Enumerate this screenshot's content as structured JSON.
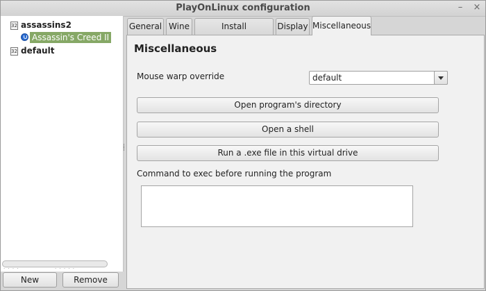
{
  "window": {
    "title": "PlayOnLinux configuration",
    "minimize_glyph": "–",
    "close_glyph": "×"
  },
  "tree": {
    "prefixes": [
      {
        "icon_text": "32",
        "label": "assassins2",
        "children": [
          {
            "label": "Assassin's Creed II",
            "selected": true
          }
        ]
      },
      {
        "icon_text": "32",
        "label": "default",
        "children": []
      }
    ]
  },
  "left_buttons": {
    "new_label": "New",
    "remove_label": "Remove"
  },
  "tabs": [
    {
      "label": "General",
      "active": false
    },
    {
      "label": "Wine",
      "active": false
    },
    {
      "label": "Install components",
      "active": false
    },
    {
      "label": "Display",
      "active": false
    },
    {
      "label": "Miscellaneous",
      "active": true
    }
  ],
  "misc": {
    "heading": "Miscellaneous",
    "mouse_warp_label": "Mouse warp override",
    "mouse_warp_value": "default",
    "open_dir_label": "Open program's directory",
    "open_shell_label": "Open a shell",
    "run_exe_label": "Run a .exe file in this virtual drive",
    "command_label": "Command to exec before running the program",
    "command_value": ""
  },
  "colors": {
    "selection": "#86a866",
    "tab_active": "#f1f1f1"
  }
}
